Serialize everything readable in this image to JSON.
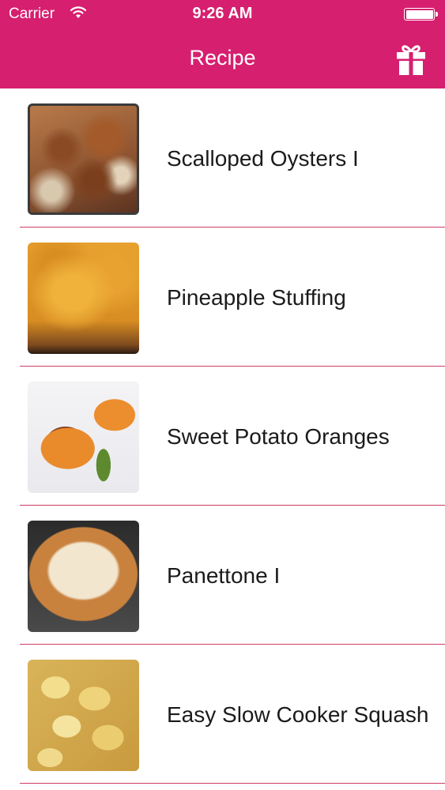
{
  "status_bar": {
    "carrier": "Carrier",
    "time": "9:26 AM"
  },
  "nav": {
    "title": "Recipe",
    "right_icon": "gift-icon"
  },
  "colors": {
    "accent": "#d61f6f",
    "separator": "#cf3c64",
    "background": "#ffffff"
  },
  "recipes": [
    {
      "title": "Scalloped Oysters I"
    },
    {
      "title": "Pineapple Stuffing"
    },
    {
      "title": "Sweet Potato Oranges"
    },
    {
      "title": "Panettone I"
    },
    {
      "title": "Easy Slow Cooker Squash"
    }
  ]
}
